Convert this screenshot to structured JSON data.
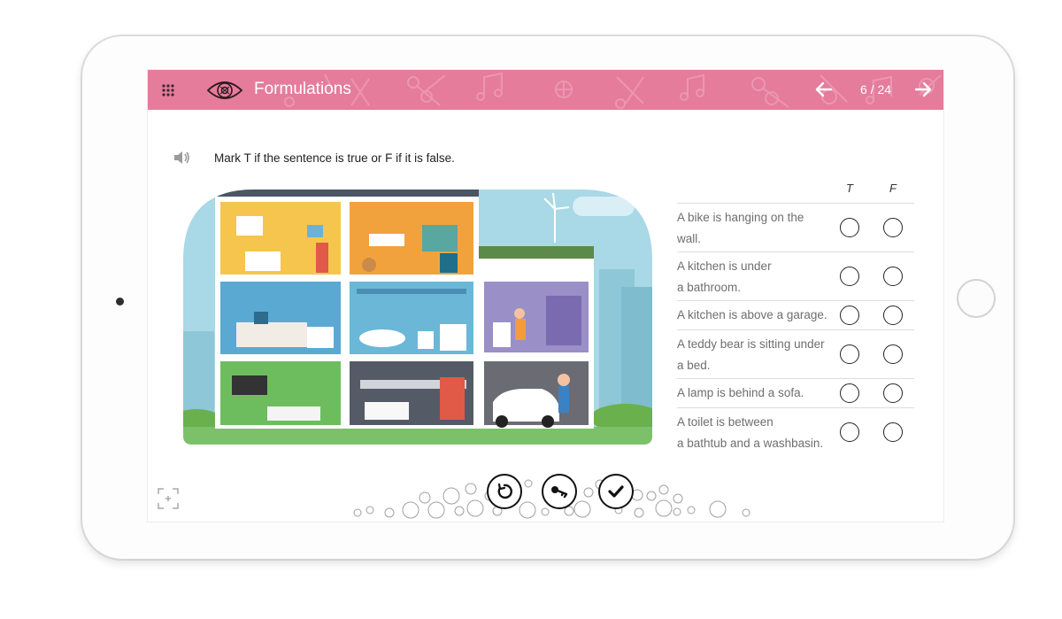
{
  "header": {
    "title": "Formulations",
    "page_counter": "6 / 24",
    "icons": {
      "menu": "grid-icon",
      "section": "eye-icon",
      "prev": "arrow-left-icon",
      "next": "arrow-right-icon"
    }
  },
  "exercise": {
    "instruction": "Mark T if the sentence is true or F if it is false.",
    "col_true": "T",
    "col_false": "F",
    "statements": [
      {
        "line1": "A bike is hanging on the",
        "line2": "wall."
      },
      {
        "line1": "A kitchen is under",
        "line2": "a bathroom."
      },
      {
        "line1": "A kitchen is above a garage.",
        "line2": ""
      },
      {
        "line1": "A teddy bear is sitting under",
        "line2": "a bed."
      },
      {
        "line1": "A lamp is behind a sofa.",
        "line2": ""
      },
      {
        "line1": "A toilet is between",
        "line2": "a bathtub and a washbasin."
      }
    ]
  },
  "actions": {
    "icons": [
      "retry-icon",
      "key-icon",
      "check-icon"
    ]
  },
  "colors": {
    "header": "#e57c9c",
    "accent_dark": "#111111"
  }
}
